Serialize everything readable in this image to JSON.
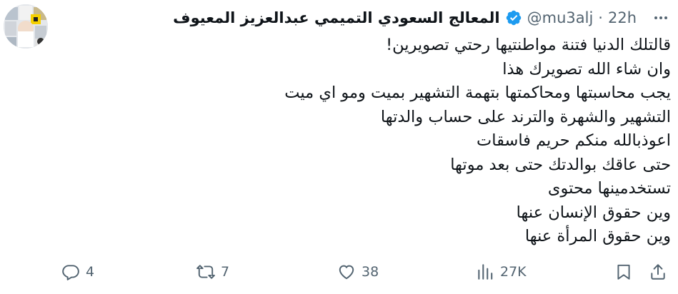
{
  "tweet": {
    "display_name": "المعالج السعودي التميمي عبدالعزيز المعيوف",
    "handle": "@mu3alj",
    "separator": "·",
    "time": "22h",
    "lines": [
      "قالتلك الدنيا فتنة مواطنتيها رحتي تصويرين!",
      "وان شاء الله تصويرك هذا",
      "يجب محاسبتها ومحاكمتها بتهمة التشهير بميت ومو اي ميت",
      "التشهير والشهرة والترند على حساب والدتها",
      "اعوذبالله منكم حريم فاسقات",
      "حتى عاقك بوالدتك حتى بعد موتها",
      "تستخدمينها محتوى",
      "وين حقوق الإنسان عنها",
      "وين حقوق المرأة عنها"
    ]
  },
  "actions": {
    "replies": "4",
    "reposts": "7",
    "likes": "38",
    "views": "27K"
  },
  "colors": {
    "verified": "#1d9bf0",
    "muted": "#536471",
    "text": "#0f1419"
  }
}
